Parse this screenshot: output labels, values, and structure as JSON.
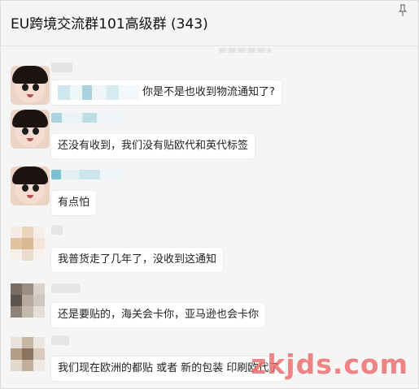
{
  "header": {
    "title": "EU跨境交流群101高级群 (343)",
    "pin_icon": "pin-icon"
  },
  "messages": [
    {
      "id": 1,
      "avatar": "child-photo-avatar",
      "text": "你是不是也收到物流通知了?"
    },
    {
      "id": 2,
      "avatar": "child-photo-avatar",
      "text": "还没有收到，我们没有贴欧代和英代标签"
    },
    {
      "id": 3,
      "avatar": "child-photo-avatar",
      "text": "有点怕"
    },
    {
      "id": 4,
      "avatar": "blurred-avatar",
      "text": "我普货走了几年了，没收到这通知"
    },
    {
      "id": 5,
      "avatar": "blurred-avatar",
      "text": "还是要贴的，海关会卡你，亚马逊也会卡你"
    },
    {
      "id": 6,
      "avatar": "blurred-avatar",
      "text": "我们现在欧洲的都贴 或者 新的包装 印刷欧代了"
    }
  ],
  "watermark": "zkjds.com"
}
